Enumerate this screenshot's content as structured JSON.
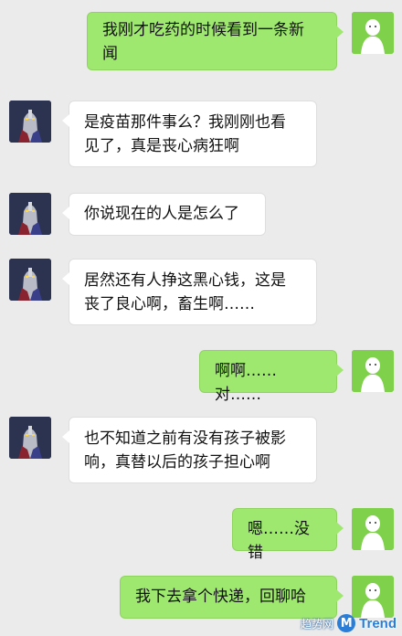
{
  "messages": [
    {
      "side": "me",
      "text_lines": [
        "我刚才吃药的时候看到一条新",
        "闻"
      ]
    },
    {
      "side": "other",
      "text_lines": [
        "是疫苗那件事么？我刚刚也看",
        "见了，真是丧心病狂啊"
      ]
    },
    {
      "side": "other",
      "text_lines": [
        "你说现在的人是怎么了"
      ]
    },
    {
      "side": "other",
      "text_lines": [
        "居然还有人挣这黑心钱，这是",
        "丧了良心啊，畜生啊……"
      ]
    },
    {
      "side": "me",
      "text_lines": [
        "啊啊……对……"
      ]
    },
    {
      "side": "other",
      "text_lines": [
        "也不知道之前有没有孩子被影",
        "响，真替以后的孩子担心啊"
      ]
    },
    {
      "side": "me",
      "text_lines": [
        "嗯……没错"
      ]
    },
    {
      "side": "me",
      "text_lines": [
        "我下去拿个快递，回聊哈"
      ]
    }
  ],
  "watermark": {
    "prefix": "趋势网",
    "brand": "Trend",
    "logo_letter": "M"
  },
  "colors": {
    "me_bubble": "#9fe870",
    "other_bubble": "#ffffff",
    "background": "#ebebeb",
    "me_avatar": "#7fd04a"
  },
  "icons": {
    "me_avatar": "stick-figure-avatar-icon",
    "other_avatar": "hero-avatar-icon"
  }
}
